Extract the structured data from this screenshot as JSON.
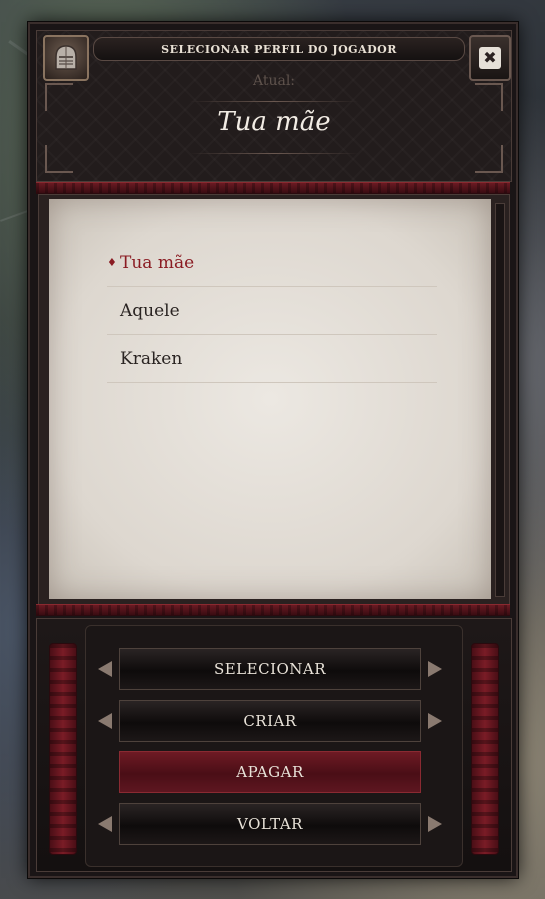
{
  "header": {
    "title": "SELECIONAR PERFIL DO JOGADOR",
    "current_label": "Atual:",
    "current_profile": "Tua mãe",
    "close_symbol": "✖"
  },
  "profiles": [
    {
      "name": "Tua mãe",
      "selected": true
    },
    {
      "name": "Aquele",
      "selected": false
    },
    {
      "name": "Kraken",
      "selected": false
    }
  ],
  "selected_marker": "♦",
  "buttons": {
    "select": "SELECIONAR",
    "create": "CRIAR",
    "delete": "APAGAR",
    "back": "VOLTAR"
  },
  "colors": {
    "accent_red": "#8a1b22",
    "panel_dark": "#1a1516",
    "parchment": "#e4dfd8"
  },
  "icons": [
    "helmet-icon",
    "close-icon",
    "diamond-bullet-icon"
  ]
}
